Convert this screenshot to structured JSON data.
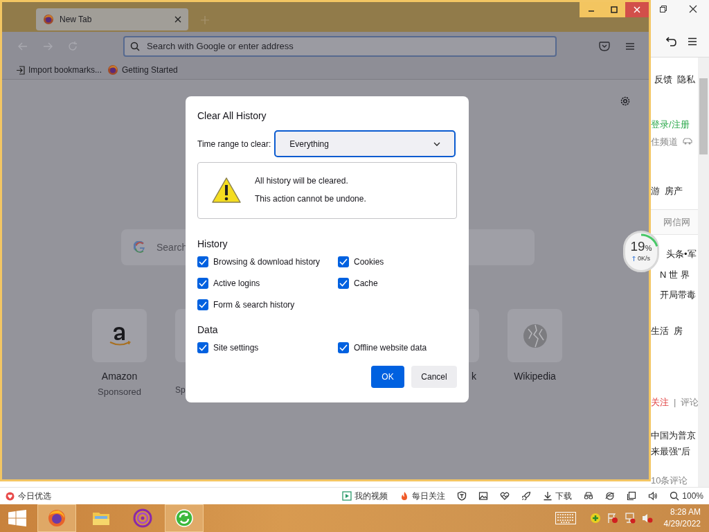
{
  "firefox": {
    "tabs": [
      {
        "title": "New Tab",
        "selected": true
      }
    ],
    "url_placeholder": "Search with Google or enter address",
    "bookmarks": [
      {
        "label": "Import bookmarks...",
        "kind": "import"
      },
      {
        "label": "Getting Started",
        "kind": "firefox"
      }
    ],
    "new_tab": {
      "search_placeholder": "Search",
      "top_sites": [
        {
          "title": "Amazon",
          "subtitle": "Sponsored",
          "kind": "amazon"
        },
        {
          "subtitle": "Sp",
          "kind": "partial-left"
        },
        {
          "kind": "hidden"
        },
        {
          "kind": "hidden"
        },
        {
          "title": "k",
          "kind": "partial-right"
        },
        {
          "title": "Wikipedia",
          "kind": "wikipedia"
        }
      ]
    }
  },
  "dialog": {
    "title": "Clear All History",
    "range_label": "Time range to clear:",
    "range_value": "Everything",
    "warning": [
      "All history will be cleared.",
      "This action cannot be undone."
    ],
    "sections": [
      {
        "heading": "History",
        "options": [
          {
            "label": "Browsing & download history",
            "checked": true
          },
          {
            "label": "Cookies",
            "checked": true
          },
          {
            "label": "Active logins",
            "checked": true
          },
          {
            "label": "Cache",
            "checked": true
          },
          {
            "label": "Form & search history",
            "checked": true
          }
        ]
      },
      {
        "heading": "Data",
        "options": [
          {
            "label": "Site settings",
            "checked": true
          },
          {
            "label": "Offline website data",
            "checked": true
          }
        ]
      }
    ],
    "buttons": [
      {
        "label": "OK",
        "kind": "primary"
      },
      {
        "label": "Cancel",
        "kind": "secondary"
      }
    ]
  },
  "side_page": {
    "rows": [
      {
        "items": [
          {
            "text": "反馈",
            "kind": "plain"
          },
          {
            "text": "隐私",
            "kind": "plain"
          }
        ]
      },
      {
        "items": [
          {
            "text": "登录/注册",
            "kind": "green"
          }
        ]
      },
      {
        "items": [
          {
            "text": "住频道",
            "kind": "muted"
          },
          {
            "kind": "icon"
          }
        ]
      },
      {
        "items": [
          {
            "text": "游",
            "kind": "plain"
          },
          {
            "text": "房产",
            "kind": "plain"
          }
        ]
      },
      {
        "items": [
          {
            "text": "网信网",
            "kind": "muted"
          }
        ]
      },
      {
        "items": [
          {
            "text": "头条•军",
            "kind": "plain"
          }
        ]
      },
      {
        "items": [
          {
            "text": "N 世 界",
            "kind": "plain"
          }
        ]
      },
      {
        "items": [
          {
            "text": "开局带毒",
            "kind": "plain"
          }
        ]
      },
      {
        "items": [
          {
            "text": "生活",
            "kind": "plain"
          },
          {
            "text": "房",
            "kind": "plain"
          }
        ]
      },
      {
        "items": [
          {
            "text": "关注",
            "kind": "red"
          },
          {
            "text": "|",
            "kind": "muted"
          },
          {
            "text": "评论",
            "kind": "muted"
          }
        ]
      },
      {
        "items": [
          {
            "text": "中国为普京",
            "kind": "plain"
          }
        ]
      },
      {
        "items": [
          {
            "text": "来最强\"后",
            "kind": "plain"
          }
        ]
      },
      {
        "items": [
          {
            "text": "10条评论",
            "kind": "muted"
          }
        ]
      }
    ]
  },
  "speed_widget": {
    "percent": "19",
    "unit": "%",
    "speed": "0K/s"
  },
  "status_bar": {
    "left": "今日优选",
    "items": [
      {
        "kind": "video",
        "label": "我的视频"
      },
      {
        "kind": "fire",
        "label": "每日关注"
      },
      {
        "kind": "shield"
      },
      {
        "kind": "image"
      },
      {
        "kind": "pulse"
      },
      {
        "kind": "rocket"
      },
      {
        "kind": "download",
        "label": "下载"
      },
      {
        "kind": "glasses"
      },
      {
        "kind": "browser"
      },
      {
        "kind": "window"
      },
      {
        "kind": "speaker"
      },
      {
        "kind": "zoom",
        "label": "100%"
      }
    ]
  },
  "taskbar": {
    "apps": [
      {
        "kind": "firefox",
        "selected": true
      },
      {
        "kind": "explorer",
        "selected": false
      },
      {
        "kind": "media",
        "selected": false
      },
      {
        "kind": "sync",
        "selected": true
      }
    ],
    "time": "8:28 AM",
    "date": "4/29/2022"
  }
}
